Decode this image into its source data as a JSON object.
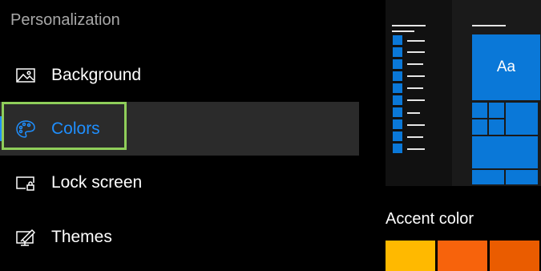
{
  "sidebar": {
    "section_title": "Personalization",
    "items": [
      {
        "label": "Background",
        "icon": "picture-icon"
      },
      {
        "label": "Colors",
        "icon": "palette-icon",
        "selected": true
      },
      {
        "label": "Lock screen",
        "icon": "lock-screen-icon"
      },
      {
        "label": "Themes",
        "icon": "themes-icon"
      }
    ]
  },
  "preview": {
    "tile_label": "Aa"
  },
  "accent": {
    "title": "Accent color",
    "swatches": [
      "#ffb900",
      "#f7630c",
      "#ea5c00"
    ]
  },
  "colors": {
    "accent": "#0a78d8",
    "selected_text": "#1f8fff",
    "highlight": "#8fce5a"
  }
}
